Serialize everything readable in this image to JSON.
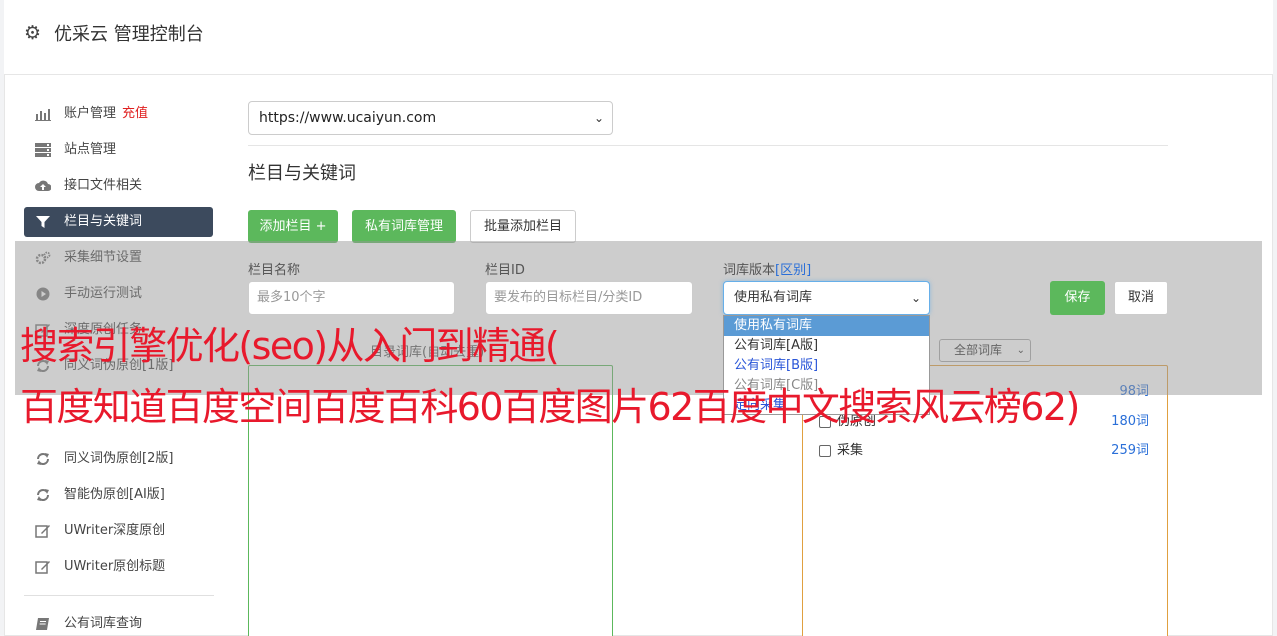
{
  "header": {
    "title": "优采云 管理控制台"
  },
  "sidebar": {
    "items": [
      {
        "label": "账户管理",
        "extra": "充值",
        "icon": "bar-chart-icon"
      },
      {
        "label": "站点管理",
        "icon": "server-icon"
      },
      {
        "label": "接口文件相关",
        "icon": "cloud-upload-icon"
      },
      {
        "label": "栏目与关键词",
        "icon": "filter-icon",
        "active": true
      },
      {
        "label": "采集细节设置",
        "icon": "cogs-icon"
      },
      {
        "label": "手动运行测试",
        "icon": "play-circle-icon"
      },
      {
        "label": "深度原创任务",
        "icon": "edit-icon"
      },
      {
        "label": "同义词伪原创[1版]",
        "icon": "refresh-icon"
      },
      {
        "label": "同义词伪原创[2版]",
        "icon": "refresh-icon"
      },
      {
        "label": "智能伪原创[AI版]",
        "icon": "refresh-icon"
      },
      {
        "label": "UWriter深度原创",
        "icon": "edit-icon"
      },
      {
        "label": "UWriter原创标题",
        "icon": "edit-icon"
      },
      {
        "label": "公有词库查询",
        "icon": "book-icon"
      }
    ]
  },
  "site_select": {
    "value": "https://www.ucaiyun.com"
  },
  "section": {
    "title": "栏目与关键词"
  },
  "buttons": {
    "add_column": "添加栏目 +",
    "private_lib": "私有词库管理",
    "batch_add": "批量添加栏目"
  },
  "form": {
    "name_label": "栏目名称",
    "name_placeholder": "最多10个字",
    "id_label": "栏目ID",
    "id_placeholder": "要发布的目标栏目/分类ID",
    "lib_label": "词库版本",
    "lib_label_link": "[区别]",
    "lib_value": "使用私有词库",
    "save": "保存",
    "cancel": "取消"
  },
  "dropdown": {
    "options": [
      "使用私有词库",
      "公有词库[A版]",
      "公有词库[B版]",
      "公有词库[C版]",
      "定向采集"
    ]
  },
  "keywords": {
    "label": "目录词库(自动去重)",
    "filter": "全部词库"
  },
  "libraries": [
    {
      "name": "伪原创",
      "count": "180词"
    },
    {
      "name": "采集",
      "count": "259词"
    }
  ],
  "library_partial_count": "98词",
  "watermark": {
    "line1": "搜索引擎优化(seo)从入门到精通(",
    "line2": "百度知道百度空间百度百科60百度图片62百度中文搜索风云榜62)"
  },
  "colors": {
    "sidebar_active_bg": "#3c4a5d",
    "primary_green": "#5cb85c",
    "link_blue": "#2a6fd8",
    "watermark_red": "#e8192c"
  }
}
